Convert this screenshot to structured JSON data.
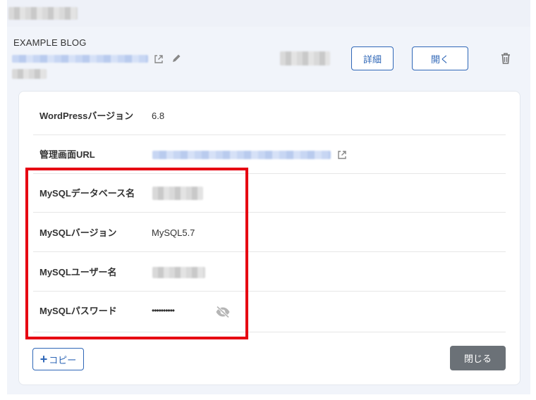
{
  "site": {
    "name": "EXAMPLE BLOG"
  },
  "header_actions": {
    "details_label": "詳細",
    "open_label": "開く"
  },
  "details": {
    "rows": [
      {
        "label": "WordPressバージョン",
        "value": "6.8"
      },
      {
        "label": "管理画面URL",
        "value": ""
      },
      {
        "label": "MySQLデータベース名",
        "value": ""
      },
      {
        "label": "MySQLバージョン",
        "value": "MySQL5.7"
      },
      {
        "label": "MySQLユーザー名",
        "value": ""
      },
      {
        "label": "MySQLパスワード",
        "value": "••••••••••"
      }
    ]
  },
  "footer": {
    "copy_label": "コピー",
    "close_label": "閉じる"
  },
  "colors": {
    "accent": "#2f67b7",
    "highlight": "#e60012",
    "close_button": "#6b7177"
  }
}
